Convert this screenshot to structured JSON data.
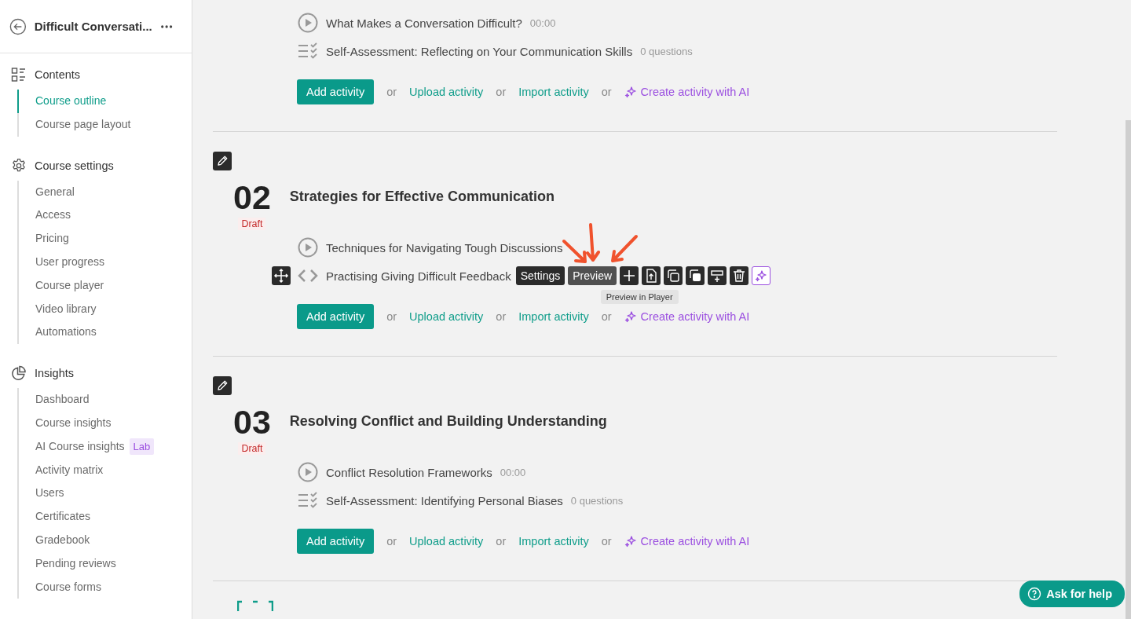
{
  "sidebar": {
    "course_title": "Difficult Conversati...",
    "groups": [
      {
        "kind": "contents",
        "title": "Contents",
        "items": [
          {
            "label": "Course outline",
            "selected": true
          },
          {
            "label": "Course page layout",
            "selected": false
          }
        ]
      },
      {
        "kind": "settings",
        "title": "Course settings",
        "items": [
          {
            "label": "General",
            "selected": false
          },
          {
            "label": "Access",
            "selected": false
          },
          {
            "label": "Pricing",
            "selected": false
          },
          {
            "label": "User progress",
            "selected": false
          },
          {
            "label": "Course player",
            "selected": false
          },
          {
            "label": "Video library",
            "selected": false
          },
          {
            "label": "Automations",
            "selected": false
          }
        ]
      },
      {
        "kind": "insights",
        "title": "Insights",
        "items": [
          {
            "label": "Dashboard",
            "selected": false
          },
          {
            "label": "Course insights",
            "selected": false
          },
          {
            "label": "AI Course insights",
            "selected": false,
            "badge": "Lab"
          },
          {
            "label": "Activity matrix",
            "selected": false
          },
          {
            "label": "Users",
            "selected": false
          },
          {
            "label": "Certificates",
            "selected": false
          },
          {
            "label": "Gradebook",
            "selected": false
          },
          {
            "label": "Pending reviews",
            "selected": false
          },
          {
            "label": "Course forms",
            "selected": false
          }
        ]
      }
    ]
  },
  "sections": [
    {
      "activities": [
        {
          "kind": "video",
          "title": "What Makes a Conversation Difficult?",
          "meta": "00:00"
        },
        {
          "kind": "quiz",
          "title": "Self-Assessment: Reflecting on Your Communication Skills",
          "meta": "0 questions"
        }
      ],
      "actions": [
        {
          "kind": "button",
          "label": "Add activity"
        },
        {
          "kind": "or",
          "label": "or"
        },
        {
          "kind": "link",
          "label": "Upload activity"
        },
        {
          "kind": "or",
          "label": "or"
        },
        {
          "kind": "link",
          "label": "Import activity"
        },
        {
          "kind": "or",
          "label": "or"
        },
        {
          "kind": "ai",
          "label": "Create activity with AI"
        }
      ]
    },
    {
      "number": "02",
      "status": "Draft",
      "title": "Strategies for Effective Communication",
      "activities": [
        {
          "kind": "video",
          "title": "Techniques for Navigating Tough Discussions"
        },
        {
          "kind": "code",
          "title": "Practising Giving Difficult Feedback",
          "toolbar": {
            "buttons": [
              {
                "label": "Settings",
                "selected": false
              },
              {
                "label": "Preview",
                "selected": true
              }
            ],
            "tooltip": "Preview in Player"
          }
        }
      ],
      "actions": [
        {
          "kind": "button",
          "label": "Add activity"
        },
        {
          "kind": "or",
          "label": "or"
        },
        {
          "kind": "link",
          "label": "Upload activity"
        },
        {
          "kind": "or",
          "label": "or"
        },
        {
          "kind": "link",
          "label": "Import activity"
        },
        {
          "kind": "or",
          "label": "or"
        },
        {
          "kind": "ai",
          "label": "Create activity with AI"
        }
      ]
    },
    {
      "number": "03",
      "status": "Draft",
      "title": "Resolving Conflict and Building Understanding",
      "activities": [
        {
          "kind": "video",
          "title": "Conflict Resolution Frameworks",
          "meta": "00:00"
        },
        {
          "kind": "quiz",
          "title": "Self-Assessment: Identifying Personal Biases",
          "meta": "0 questions"
        }
      ],
      "actions": [
        {
          "kind": "button",
          "label": "Add activity"
        },
        {
          "kind": "or",
          "label": "or"
        },
        {
          "kind": "link",
          "label": "Upload activity"
        },
        {
          "kind": "or",
          "label": "or"
        },
        {
          "kind": "link",
          "label": "Import activity"
        },
        {
          "kind": "or",
          "label": "or"
        },
        {
          "kind": "ai",
          "label": "Create activity with AI"
        }
      ]
    }
  ],
  "help_button": {
    "label": "Ask for help"
  }
}
